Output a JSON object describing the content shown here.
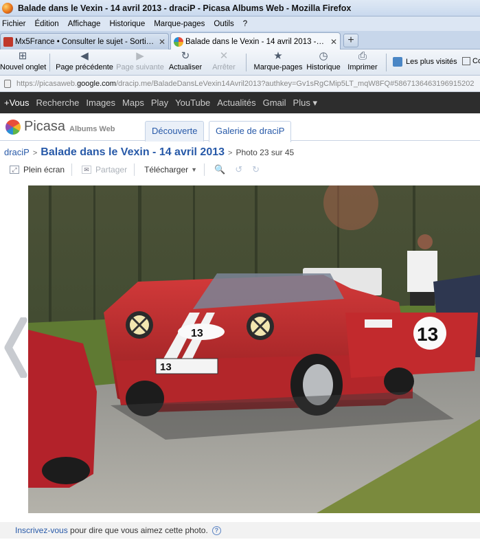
{
  "window": {
    "title": "Balade dans le Vexin - 14 avril 2013 - draciP - Picasa Albums Web - Mozilla Firefox"
  },
  "menu": [
    "Fichier",
    "Édition",
    "Affichage",
    "Historique",
    "Marque-pages",
    "Outils",
    "?"
  ],
  "tabs": [
    {
      "label": "Mx5France • Consulter le sujet - Sortie V...",
      "active": false
    },
    {
      "label": "Balade dans le Vexin - 14 avril 2013 - dra...",
      "active": true
    }
  ],
  "new_tab_label": "+",
  "toolbar": {
    "new_tab": "Nouvel onglet",
    "back": "Page précédente",
    "forward": "Page suivante",
    "reload": "Actualiser",
    "stop": "Arrêter",
    "bookmarks": "Marque-pages",
    "history": "Historique",
    "print": "Imprimer",
    "most_visited": "Les plus visités",
    "more": "Co"
  },
  "url": {
    "prefix": "https://picasaweb.",
    "domain": "google.com",
    "rest": "/dracip.me/BaladeDansLeVexin14Avril2013?authkey=Gv1sRgCMip5LT_mqW8FQ#5867136463196915202"
  },
  "google_bar": [
    "+Vous",
    "Recherche",
    "Images",
    "Maps",
    "Play",
    "YouTube",
    "Actualités",
    "Gmail",
    "Plus ▾"
  ],
  "picasa": {
    "logo_text": "Picasa",
    "logo_tm": "™",
    "logo_sub": "Albums Web",
    "tabs": [
      "Découverte",
      "Galerie de draciP"
    ]
  },
  "breadcrumb": {
    "user": "draciP",
    "album": "Balade dans le Vexin - 14 avril 2013",
    "photo": "Photo 23 sur 45",
    "separator": ">"
  },
  "photo_toolbar": {
    "fullscreen": "Plein écran",
    "share": "Partager",
    "download": "Télécharger"
  },
  "photo": {
    "plate_number": "13",
    "door_number": "13",
    "hood_number": "13"
  },
  "footer": {
    "link": "Inscrivez-vous",
    "text": " pour dire que vous aimez cette photo.",
    "help": "?"
  }
}
